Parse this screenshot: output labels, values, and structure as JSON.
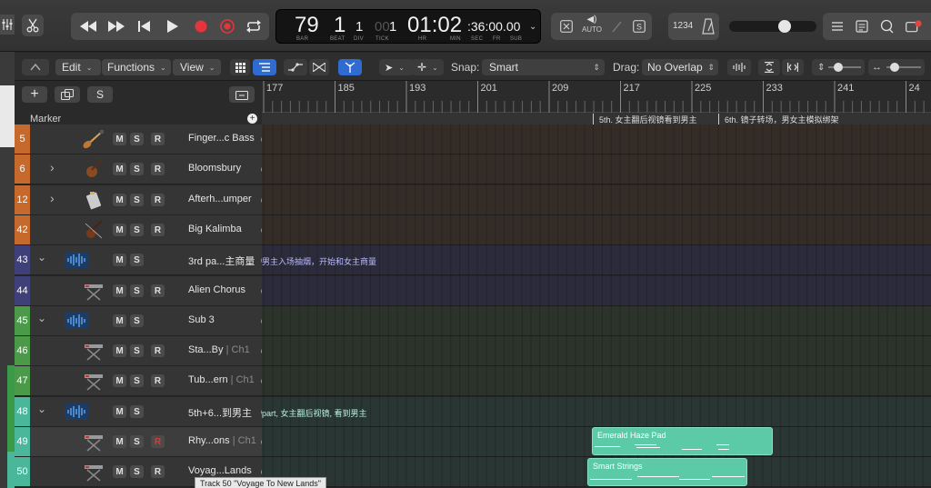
{
  "transport": {
    "bar": "79",
    "beat": "1",
    "div": "1",
    "tick_prefix": "00",
    "tick": "1",
    "time_main": "01:02",
    "time_rest": ":36:00.00",
    "labels": {
      "bar": "BAR",
      "beat": "BEAT",
      "div": "DIV",
      "tick": "TICK",
      "hr": "HR",
      "min": "MIN",
      "sec": "SEC",
      "fr": "FR",
      "sub": "SUB"
    },
    "auto_label": "AUTO",
    "count_in": "1234"
  },
  "toolbar": {
    "edit": "Edit",
    "functions": "Functions",
    "view": "View",
    "snap_label": "Snap:",
    "snap_value": "Smart",
    "drag_label": "Drag:",
    "drag_value": "No Overlap"
  },
  "ruler": {
    "bars": [
      "177",
      "185",
      "193",
      "201",
      "209",
      "217",
      "225",
      "233",
      "241",
      "24"
    ]
  },
  "marker_lane": {
    "title": "Marker",
    "markers": [
      {
        "text": "5th. 女主翻后视镜看到男主"
      },
      {
        "text": "6th. 镜子转场，男女主模拟绑架"
      }
    ]
  },
  "tracks": [
    {
      "num": "5",
      "name": "Finger...c Bass",
      "sub": "",
      "icon": "bass-guitar-icon",
      "color": "#c56a2c",
      "lane": "#342d27",
      "r_active": false,
      "disclosure": false
    },
    {
      "num": "6",
      "name": "Bloomsbury",
      "sub": "",
      "icon": "cello-icon",
      "color": "#c56a2c",
      "lane": "#342d27",
      "r_active": false,
      "disclosure": true
    },
    {
      "num": "12",
      "name": "Afterh...umper",
      "sub": "",
      "icon": "sampler-icon",
      "color": "#c56a2c",
      "lane": "#342d27",
      "r_active": false,
      "disclosure": true
    },
    {
      "num": "42",
      "name": "Big Kalimba",
      "sub": "",
      "icon": "violin-icon",
      "color": "#c56a2c",
      "lane": "#342d27",
      "r_active": false,
      "disclosure": false
    },
    {
      "num": "43",
      "name": "3rd pa...主商量",
      "sub": "",
      "icon": "audio-waveform-icon",
      "color": "#3f3f7a",
      "lane": "#2b2b3b",
      "r_active": false,
      "disclosure": true,
      "folder": true
    },
    {
      "num": "44",
      "name": "Alien Chorus",
      "sub": "",
      "icon": "keyboard-stand-icon",
      "color": "#3f3f7a",
      "lane": "#2b2b3b",
      "r_active": false,
      "disclosure": false
    },
    {
      "num": "45",
      "name": "Sub 3",
      "sub": "",
      "icon": "audio-waveform-icon",
      "color": "#4a9a4a",
      "lane": "#2c332b",
      "r_active": false,
      "disclosure": true,
      "folder": true
    },
    {
      "num": "46",
      "name": "Sta...By",
      "sub": " | Ch1",
      "icon": "keyboard-stand-icon",
      "color": "#4a9a4a",
      "lane": "#2c332b",
      "r_active": false,
      "disclosure": false
    },
    {
      "num": "47",
      "name": "Tub...ern",
      "sub": " | Ch1",
      "icon": "keyboard-stand-icon",
      "color": "#4a9a4a",
      "lane": "#2c332b",
      "r_active": false,
      "disclosure": false
    },
    {
      "num": "48",
      "name": "5th+6...到男主",
      "sub": "",
      "icon": "audio-waveform-icon",
      "color": "#4ab79a",
      "lane": "#2a3634",
      "r_active": false,
      "disclosure": true,
      "folder": true
    },
    {
      "num": "49",
      "name": "Rhy...ons",
      "sub": " | Ch1",
      "icon": "keyboard-stand-icon",
      "color": "#4ab79a",
      "lane": "#2a3634",
      "r_active": true,
      "disclosure": false
    },
    {
      "num": "50",
      "name": "Voyag...Lands",
      "sub": "",
      "icon": "keyboard-stand-icon",
      "color": "#4ab79a",
      "lane": "#2a3634",
      "r_active": false,
      "disclosure": false
    }
  ],
  "msr": {
    "m": "M",
    "s": "S",
    "r": "R"
  },
  "lane_labels": [
    {
      "text": "男主入场抽烟，开始和女主商量",
      "color": "#b9b9ff"
    },
    {
      "text": "part, 女主翻后视镜, 看到男主",
      "color": "#b8f0e0"
    }
  ],
  "regions": [
    {
      "name": "Emerald Haze Pad",
      "color": "#5ccaa6"
    },
    {
      "name": "Smart Strings",
      "color": "#5ccaa6"
    }
  ],
  "tooltip": "Track 50 \"Voyage To New Lands\""
}
